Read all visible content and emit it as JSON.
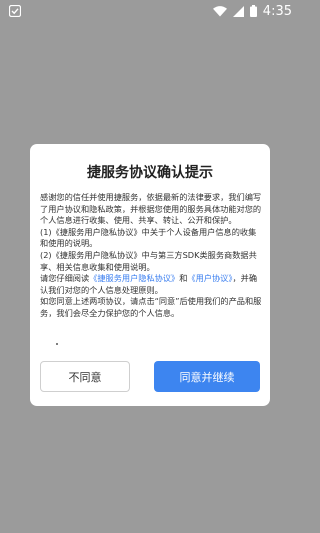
{
  "status_bar": {
    "time": "4:35",
    "icons": [
      "app-notification-icon",
      "wifi-icon",
      "cellular-signal-icon",
      "battery-icon"
    ]
  },
  "dialog": {
    "title": "捷服务协议确认提示",
    "intro": "感谢您的信任并使用捷服务，依据最新的法律要求，我们编写了用户协议和隐私政策，并根据您使用的服务具体功能对您的个人信息进行收集、使用、共享、转让、公开和保护。",
    "item1": "(1)《捷服务用户隐私协议》中关于个人设备用户信息的收集和使用的说明。",
    "item2": "(2)《捷服务用户隐私协议》中与第三方SDK类服务商数据共享、相关信息收集和使用说明。",
    "read_prefix": "请您仔细阅读",
    "link_privacy": "《捷服务用户隐私协议》",
    "read_and": "和",
    "link_user": "《用户协议》",
    "read_suffix": "，并确认我们对您的个人信息处理原则。",
    "closing": "如您同意上述两项协议，请点击“同意”后使用我们的产品和服务，我们会尽全力保护您的个人信息。",
    "disagree_label": "不同意",
    "agree_label": "同意并继续"
  },
  "colors": {
    "overlay": "#9b9b9b",
    "link": "#3b7ff0",
    "primary_button": "#3d85f0"
  }
}
